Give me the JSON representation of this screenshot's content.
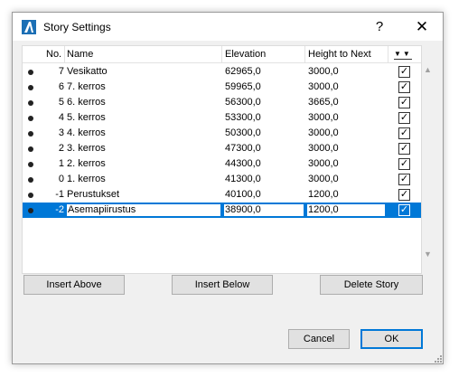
{
  "window": {
    "title": "Story Settings",
    "help_label": "?",
    "close_label": "✕"
  },
  "table": {
    "columns": {
      "no": "No.",
      "name": "Name",
      "elevation": "Elevation",
      "height_to_next": "Height to Next",
      "show_icon": "▼▼"
    },
    "rows": [
      {
        "no": "7",
        "name": "Vesikatto",
        "elevation": "62965,0",
        "height": "3000,0",
        "checked": "✓"
      },
      {
        "no": "6",
        "name": "7. kerros",
        "elevation": "59965,0",
        "height": "3000,0",
        "checked": "✓"
      },
      {
        "no": "5",
        "name": "6. kerros",
        "elevation": "56300,0",
        "height": "3665,0",
        "checked": "✓"
      },
      {
        "no": "4",
        "name": "5. kerros",
        "elevation": "53300,0",
        "height": "3000,0",
        "checked": "✓"
      },
      {
        "no": "3",
        "name": "4. kerros",
        "elevation": "50300,0",
        "height": "3000,0",
        "checked": "✓"
      },
      {
        "no": "2",
        "name": "3. kerros",
        "elevation": "47300,0",
        "height": "3000,0",
        "checked": "✓"
      },
      {
        "no": "1",
        "name": "2. kerros",
        "elevation": "44300,0",
        "height": "3000,0",
        "checked": "✓"
      },
      {
        "no": "0",
        "name": "1. kerros",
        "elevation": "41300,0",
        "height": "3000,0",
        "checked": "✓"
      },
      {
        "no": "-1",
        "name": "Perustukset",
        "elevation": "40100,0",
        "height": "1200,0",
        "checked": "✓"
      },
      {
        "no": "-2",
        "name": "Asemapiirustus",
        "elevation": "38900,0",
        "height": "1200,0",
        "checked": "✓"
      }
    ]
  },
  "scroll": {
    "up": "▲",
    "down": "▼"
  },
  "buttons": {
    "insert_above": "Insert Above",
    "insert_below": "Insert Below",
    "delete_story": "Delete Story",
    "cancel": "Cancel",
    "ok": "OK"
  },
  "colors": {
    "selection": "#0078d7",
    "window_bg": "#f0f0f0"
  }
}
